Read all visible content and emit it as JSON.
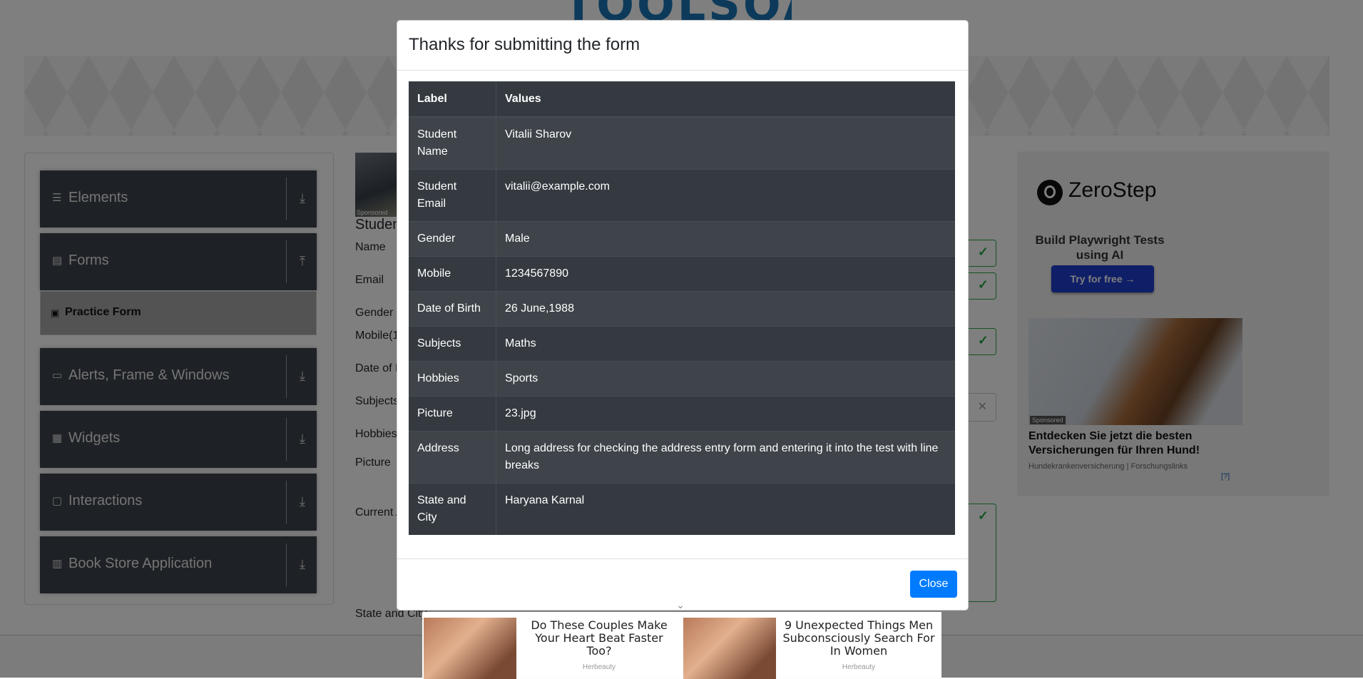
{
  "background": {
    "logo_text": "TOOLSQA",
    "sidebar": {
      "groups": [
        {
          "label": "Elements",
          "icon": "hamburger-icon",
          "arrow": "download-icon"
        },
        {
          "label": "Forms",
          "icon": "document-icon",
          "arrow": "upload-icon"
        },
        {
          "label": "Alerts, Frame & Windows",
          "icon": "window-icon",
          "arrow": "download-icon"
        },
        {
          "label": "Widgets",
          "icon": "grid-icon",
          "arrow": "download-icon"
        },
        {
          "label": "Interactions",
          "icon": "interact-icon",
          "arrow": "download-icon"
        },
        {
          "label": "Book Store Application",
          "icon": "books-icon",
          "arrow": "download-icon"
        }
      ],
      "active_item": "Practice Form"
    },
    "form": {
      "heading": "Studen",
      "sponsored": "Sponsored",
      "labels": {
        "name": "Name",
        "email": "Email",
        "gender": "Gender",
        "mobile": "Mobile(1",
        "dob": "Date of B",
        "subjects": "Subjects",
        "hobbies": "Hobbies",
        "picture": "Picture",
        "current_address": "Current A",
        "state_city": "State and City"
      }
    },
    "ad_right": {
      "brand": "ZeroStep",
      "tagline": "Build Playwright Tests using AI",
      "cta": "Try for free →",
      "sponsored": "Sponsored",
      "headline": "Entdecken Sie jetzt die besten Versicherungen für Ihren Hund!",
      "source": "Hundekrankenversicherung | Forschungslinks",
      "adchoice": "[?]"
    },
    "bottom_ads": [
      {
        "text": "Do These Couples Make Your Heart Beat Faster Too?",
        "source": "Herbeauty"
      },
      {
        "text": "9 Unexpected Things Men Subconsciously Search For In Women",
        "source": "Herbeauty"
      }
    ]
  },
  "modal": {
    "title": "Thanks for submitting the form",
    "table": {
      "headers": [
        "Label",
        "Values"
      ],
      "rows": [
        {
          "label": "Student Name",
          "value": "Vitalii Sharov"
        },
        {
          "label": "Student Email",
          "value": "vitalii@example.com"
        },
        {
          "label": "Gender",
          "value": "Male"
        },
        {
          "label": "Mobile",
          "value": "1234567890"
        },
        {
          "label": "Date of Birth",
          "value": "26 June,1988"
        },
        {
          "label": "Subjects",
          "value": "Maths"
        },
        {
          "label": "Hobbies",
          "value": "Sports"
        },
        {
          "label": "Picture",
          "value": "23.jpg"
        },
        {
          "label": "Address",
          "value": "Long address for checking the address entry form and entering it into the test with line breaks"
        },
        {
          "label": "State and City",
          "value": "Haryana Karnal"
        }
      ]
    },
    "close_label": "Close"
  }
}
